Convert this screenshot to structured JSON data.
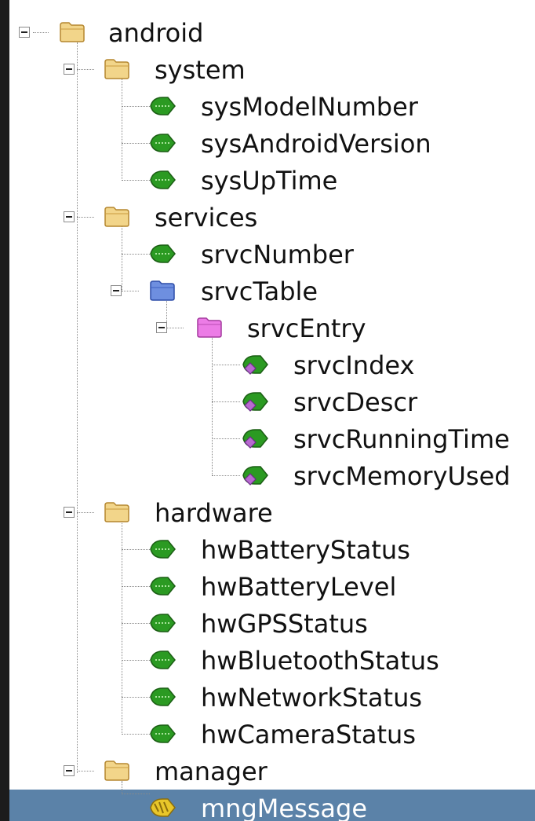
{
  "tree": {
    "root": "android",
    "groups": {
      "system": {
        "label": "system",
        "items": [
          "sysModelNumber",
          "sysAndroidVersion",
          "sysUpTime"
        ]
      },
      "services": {
        "label": "services",
        "number": "srvcNumber",
        "table": "srvcTable",
        "entry": "srvcEntry",
        "columns": [
          "srvcIndex",
          "srvcDescr",
          "srvcRunningTime",
          "srvcMemoryUsed"
        ]
      },
      "hardware": {
        "label": "hardware",
        "items": [
          "hwBatteryStatus",
          "hwBatteryLevel",
          "hwGPSStatus",
          "hwBluetoothStatus",
          "hwNetworkStatus",
          "hwCameraStatus"
        ]
      },
      "manager": {
        "label": "manager",
        "items": [
          "mngMessage"
        ]
      }
    },
    "selected": "mngMessage"
  },
  "colors": {
    "folder": "#f2d58a",
    "table_folder": "#6e8fe0",
    "entry_folder": "#ec7ce6",
    "leaf": "#2b9a22",
    "column_badge": "#b86ad0",
    "notification": "#e8c62a",
    "selection": "#5b82a8"
  },
  "icons": {
    "expander": "collapse-minus-icon",
    "folder": "folder-icon",
    "table": "table-folder-icon",
    "entry": "entry-folder-icon",
    "leaf": "leaf-icon",
    "column": "column-leaf-icon",
    "notification": "notification-leaf-icon"
  }
}
